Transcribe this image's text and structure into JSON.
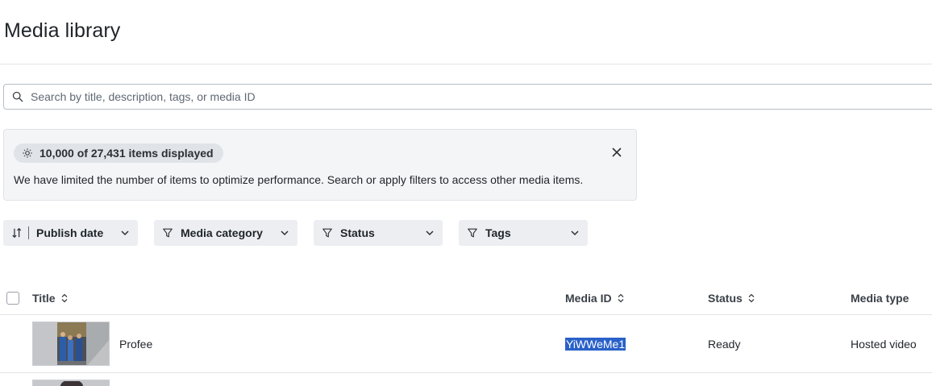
{
  "page": {
    "title": "Media library"
  },
  "search": {
    "placeholder": "Search by title, description, tags, or media ID",
    "value": ""
  },
  "notice": {
    "badge": "10,000 of 27,431 items displayed",
    "message": "We have limited the number of items to optimize performance. Search or apply filters to access other media items."
  },
  "filters": {
    "sort": {
      "label": "Publish date",
      "icon": "sort-icon"
    },
    "items": [
      {
        "label": "Media category",
        "icon": "filter-icon"
      },
      {
        "label": "Status",
        "icon": "filter-icon"
      },
      {
        "label": "Tags",
        "icon": "filter-icon"
      }
    ]
  },
  "table": {
    "columns": [
      "Title",
      "Media ID",
      "Status",
      "Media type"
    ],
    "rows": [
      {
        "title": "Profee",
        "media_id": "YiWWeMe1",
        "status": "Ready",
        "media_type": "Hosted video"
      }
    ]
  },
  "colors": {
    "accent": "#2a61c9",
    "panel": "#f4f5f7",
    "filter_bg": "#eceef1"
  }
}
